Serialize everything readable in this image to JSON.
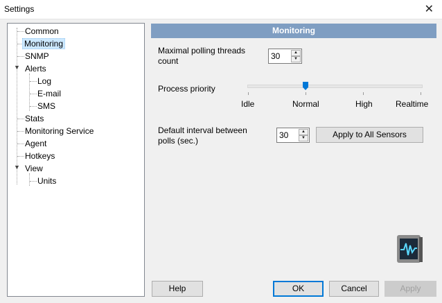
{
  "window": {
    "title": "Settings"
  },
  "tree": {
    "items": [
      {
        "label": "Common"
      },
      {
        "label": "Monitoring"
      },
      {
        "label": "SNMP"
      },
      {
        "label": "Alerts"
      },
      {
        "label": "Log"
      },
      {
        "label": "E-mail"
      },
      {
        "label": "SMS"
      },
      {
        "label": "Stats"
      },
      {
        "label": "Monitoring Service"
      },
      {
        "label": "Agent"
      },
      {
        "label": "Hotkeys"
      },
      {
        "label": "View"
      },
      {
        "label": "Units"
      }
    ]
  },
  "panel": {
    "header": "Monitoring",
    "threads_label": "Maximal polling threads count",
    "threads_value": "30",
    "priority_label": "Process priority",
    "priority_ticks": [
      "Idle",
      "Normal",
      "High",
      "Realtime"
    ],
    "priority_selected": "Normal",
    "interval_label": "Default interval between polls (sec.)",
    "interval_value": "30",
    "apply_all_label": "Apply to All Sensors"
  },
  "footer": {
    "help": "Help",
    "ok": "OK",
    "cancel": "Cancel",
    "apply": "Apply"
  }
}
